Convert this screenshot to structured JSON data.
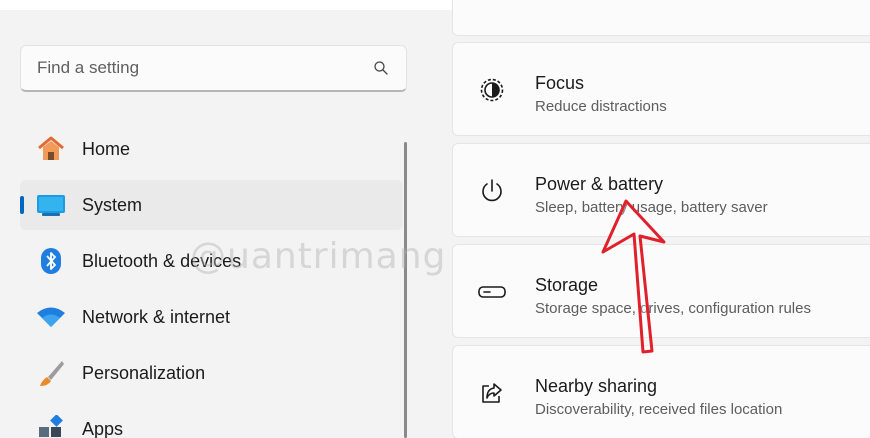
{
  "search": {
    "placeholder": "Find a setting",
    "icon": "search-icon"
  },
  "sidebar": {
    "items": [
      {
        "label": "Home",
        "icon": "home-icon",
        "active": false
      },
      {
        "label": "System",
        "icon": "system-icon",
        "active": true
      },
      {
        "label": "Bluetooth & devices",
        "icon": "bluetooth-icon",
        "active": false
      },
      {
        "label": "Network & internet",
        "icon": "wifi-icon",
        "active": false
      },
      {
        "label": "Personalization",
        "icon": "brush-icon",
        "active": false
      },
      {
        "label": "Apps",
        "icon": "apps-icon",
        "active": false
      }
    ]
  },
  "cards": [
    {
      "title": "Focus",
      "desc": "Reduce distractions",
      "icon": "focus-icon"
    },
    {
      "title": "Power & battery",
      "desc": "Sleep, battery usage, battery saver",
      "icon": "power-icon"
    },
    {
      "title": "Storage",
      "desc": "Storage space, drives, configuration rules",
      "icon": "storage-icon"
    },
    {
      "title": "Nearby sharing",
      "desc": "Discoverability, received files location",
      "icon": "share-icon"
    }
  ],
  "watermark": "@uantrimang",
  "colors": {
    "accent": "#0067c0",
    "arrow": "#e0202a",
    "background": "#f3f3f3",
    "card": "#fbfbfb"
  }
}
